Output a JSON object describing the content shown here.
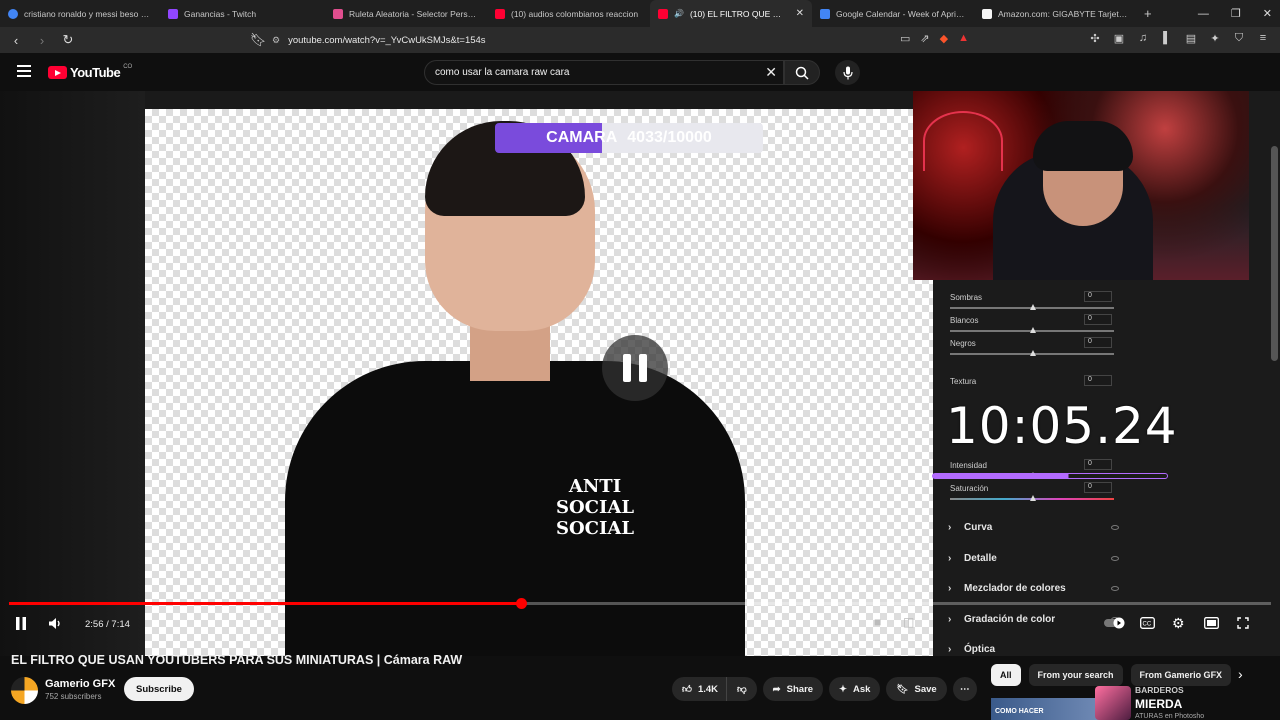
{
  "browser": {
    "tabs": [
      {
        "title": "cristiano ronaldo y messi beso - Goo",
        "color": "#4285f4"
      },
      {
        "title": "Ganancias - Twitch",
        "color": "#9146ff"
      },
      {
        "title": "Ruleta Aleatoria - Selector Personali",
        "color": "#e04e8e"
      },
      {
        "title": "(10) audios colombianos reaccion",
        "color": "#ff0033"
      },
      {
        "title": "(10) EL FILTRO QUE USAN YO",
        "color": "#ff0033",
        "active": true
      },
      {
        "title": "Google Calendar - Week of April 5, 2",
        "color": "#4285f4"
      },
      {
        "title": "Amazon.com: GIGABYTE Tarjeta gráf",
        "color": "#f5f5f5"
      }
    ],
    "url": "youtube.com/watch?v=_YvCwUkSMJs&t=154s"
  },
  "youtube": {
    "logo_text": "YouTube",
    "logo_suffix": "CO",
    "search_value": "como usar la camara raw cara"
  },
  "video": {
    "counter_label": "CAMARA",
    "counter_value": "4033/10000",
    "shirt_lines": [
      "ANTI",
      "SOCIAL",
      "SOCIAL"
    ],
    "clock": "10:05.24",
    "sliders": [
      {
        "label": "Sombras",
        "value": "0"
      },
      {
        "label": "Blancos",
        "value": "0"
      },
      {
        "label": "Negros",
        "value": "0"
      },
      {
        "label": "Textura",
        "value": "0"
      },
      {
        "label": "Intensidad",
        "value": "0"
      },
      {
        "label": "Saturación",
        "value": "0"
      }
    ],
    "sections": [
      "Curva",
      "Detalle",
      "Mezclador de colores",
      "Gradación de color",
      "Óptica"
    ],
    "current_time": "2:56",
    "duration": "7:14",
    "progress_fraction": 0.406
  },
  "meta": {
    "title": "EL FILTRO QUE USAN YOUTUBERS PARA SUS MINIATURAS | Cámara RAW",
    "channel": "Gamerio GFX",
    "subscribers": "752 subscribers",
    "subscribe_label": "Subscribe",
    "likes": "1.4K",
    "share_label": "Share",
    "ask_label": "Ask",
    "save_label": "Save"
  },
  "related": {
    "chips": [
      "All",
      "From your search",
      "From Gamerio GFX"
    ],
    "thumb_text": "COMO HACER",
    "promo_top": "BARDEROS",
    "promo_main": "MIERDA",
    "promo_sub": "ATURAS en Photosho"
  },
  "colors": {
    "brand_red": "#ff0033",
    "accent_purple": "#b36bff"
  }
}
